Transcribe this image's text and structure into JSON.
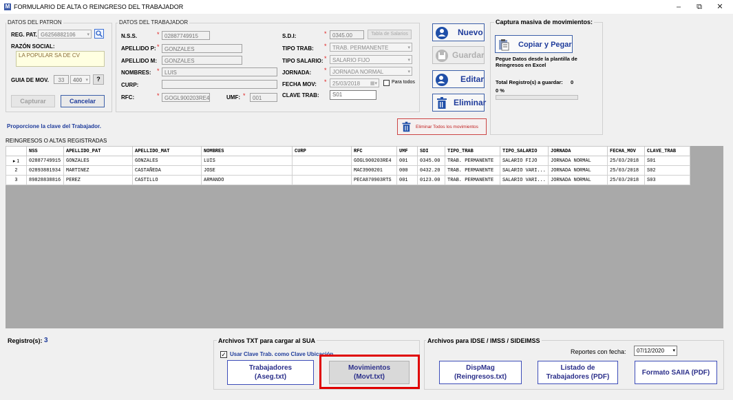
{
  "window": {
    "title": "FORMULARIO DE ALTA O REINGRESO DEL TRABAJADOR",
    "app_icon": "M",
    "minimize": "–",
    "restore": "⧉",
    "close": "✕"
  },
  "patron": {
    "group_label": "DATOS DEL PATRON",
    "reg_pat_label": "REG. PAT.",
    "reg_pat_value": "G6256882106",
    "razon_social_label": "RAZÓN SOCIAL:",
    "razon_social_value": "LA POPULAR SA DE CV",
    "guia_label": "GUIA DE MOV.",
    "guia_num": "33",
    "guia_combo": "400",
    "help_label": "?",
    "capturar_label": "Capturar",
    "cancelar_label": "Cancelar"
  },
  "trabajador": {
    "group_label": "DATOS DEL TRABAJADOR",
    "nss_label": "N.S.S.",
    "nss_value": "02887749915",
    "ap_pat_label": "APELLIDO P:",
    "ap_pat_value": "GONZALES",
    "ap_mat_label": "APELLIDO M:",
    "ap_mat_value": "GONZALES",
    "nombres_label": "NOMBRES:",
    "nombres_value": "LUIS",
    "curp_label": "CURP:",
    "curp_value": "",
    "rfc_label": "RFC:",
    "rfc_value": "GOGL900203RE4",
    "umf_label": "UMF:",
    "umf_value": "001",
    "sdi_label": "S.D.I:",
    "sdi_value": "0345.00",
    "tabla_salarios_label": "Tabla de Salarios",
    "tipo_trab_label": "TIPO TRAB:",
    "tipo_trab_value": "TRAB. PERMANENTE",
    "tipo_salario_label": "TIPO SALARIO:",
    "tipo_salario_value": "SALARIO FIJO",
    "jornada_label": "JORNADA:",
    "jornada_value": "JORNADA NORMAL",
    "fecha_mov_label": "FECHA MOV:",
    "fecha_mov_value": "25/03/2018",
    "para_todos_label": "Para todos",
    "clave_trab_label": "CLAVE TRAB:",
    "clave_trab_value": "S01"
  },
  "actions": {
    "nuevo": "Nuevo",
    "guardar": "Guardar",
    "editar": "Editar",
    "eliminar": "Eliminar",
    "eliminar_todos": "Eliminar Todos los movimientos"
  },
  "captura": {
    "title": "Captura masiva de movimientos:",
    "copiar_pegar": "Copiar y Pegar",
    "instruction": "Pegue Datos desde la plantilla de Reingresos en Excel",
    "total_label": "Total Registro(s) a guardar:",
    "total_value": "0",
    "percent": "0 %"
  },
  "status_message": "Proporcione la clave del Trabajador.",
  "grid": {
    "label": "REINGRESOS O ALTAS REGISTRADAS",
    "columns": [
      "NSS",
      "APELLIDO_PAT",
      "APELLIDO_MAT",
      "NOMBRES",
      "CURP",
      "RFC",
      "UMF",
      "SDI",
      "TIPO_TRAB",
      "TIPO_SALARIO",
      "JORNADA",
      "FECHA_MOV",
      "CLAVE_TRAB"
    ],
    "rows": [
      {
        "rh": "▸ 1",
        "cells": [
          "02887749915",
          "GONZALES",
          "GONZALES",
          "LUIS",
          "",
          "GOGL900203RE4",
          "001",
          "0345.00",
          "TRAB. PERMANENTE",
          "SALARIO FIJO",
          "JORNADA NORMAL",
          "25/03/2018",
          "S01"
        ]
      },
      {
        "rh": "2",
        "cells": [
          "02893881934",
          "MARTINEZ",
          "CASTAÑEDA",
          "JOSE",
          "",
          "MAC3900201",
          "000",
          "0432.20",
          "TRAB. PERMANENTE",
          "SALARIO VARI...",
          "JORNADA NORMAL",
          "25/03/2018",
          "S02"
        ]
      },
      {
        "rh": "3",
        "cells": [
          "89828838816",
          "PEREZ",
          "CASTILLO",
          "ARMANDO",
          "",
          "PECA870903RTS",
          "001",
          "0123.00",
          "TRAB. PERMANENTE",
          "SALARIO VARI...",
          "JORNADA NORMAL",
          "25/03/2018",
          "S03"
        ]
      }
    ]
  },
  "footer": {
    "registros_label": "Registro(s):",
    "registros_value": "3",
    "txt_group_label": "Archivos  TXT para cargar al SUA",
    "usar_clave_label": "Usar Clave Trab. como Clave Ubicación",
    "trabajadores_btn": "Trabajadores\n(Aseg.txt)",
    "movimientos_btn": "Movimientos\n(Movt.txt)",
    "idse_group_label": "Archivos para IDSE / IMSS / SIDEIMSS",
    "reportes_label": "Reportes con fecha:",
    "reportes_fecha": "07/12/2020",
    "dispmag_btn": "DispMag\n(Reingresos.txt)",
    "listado_btn": "Listado de\nTrabajadores (PDF)",
    "formato_btn": "Formato SAIIA (PDF)"
  },
  "colors": {
    "accent_blue": "#1f3c9b",
    "highlight_red": "#e00000",
    "required": "#e02020"
  }
}
